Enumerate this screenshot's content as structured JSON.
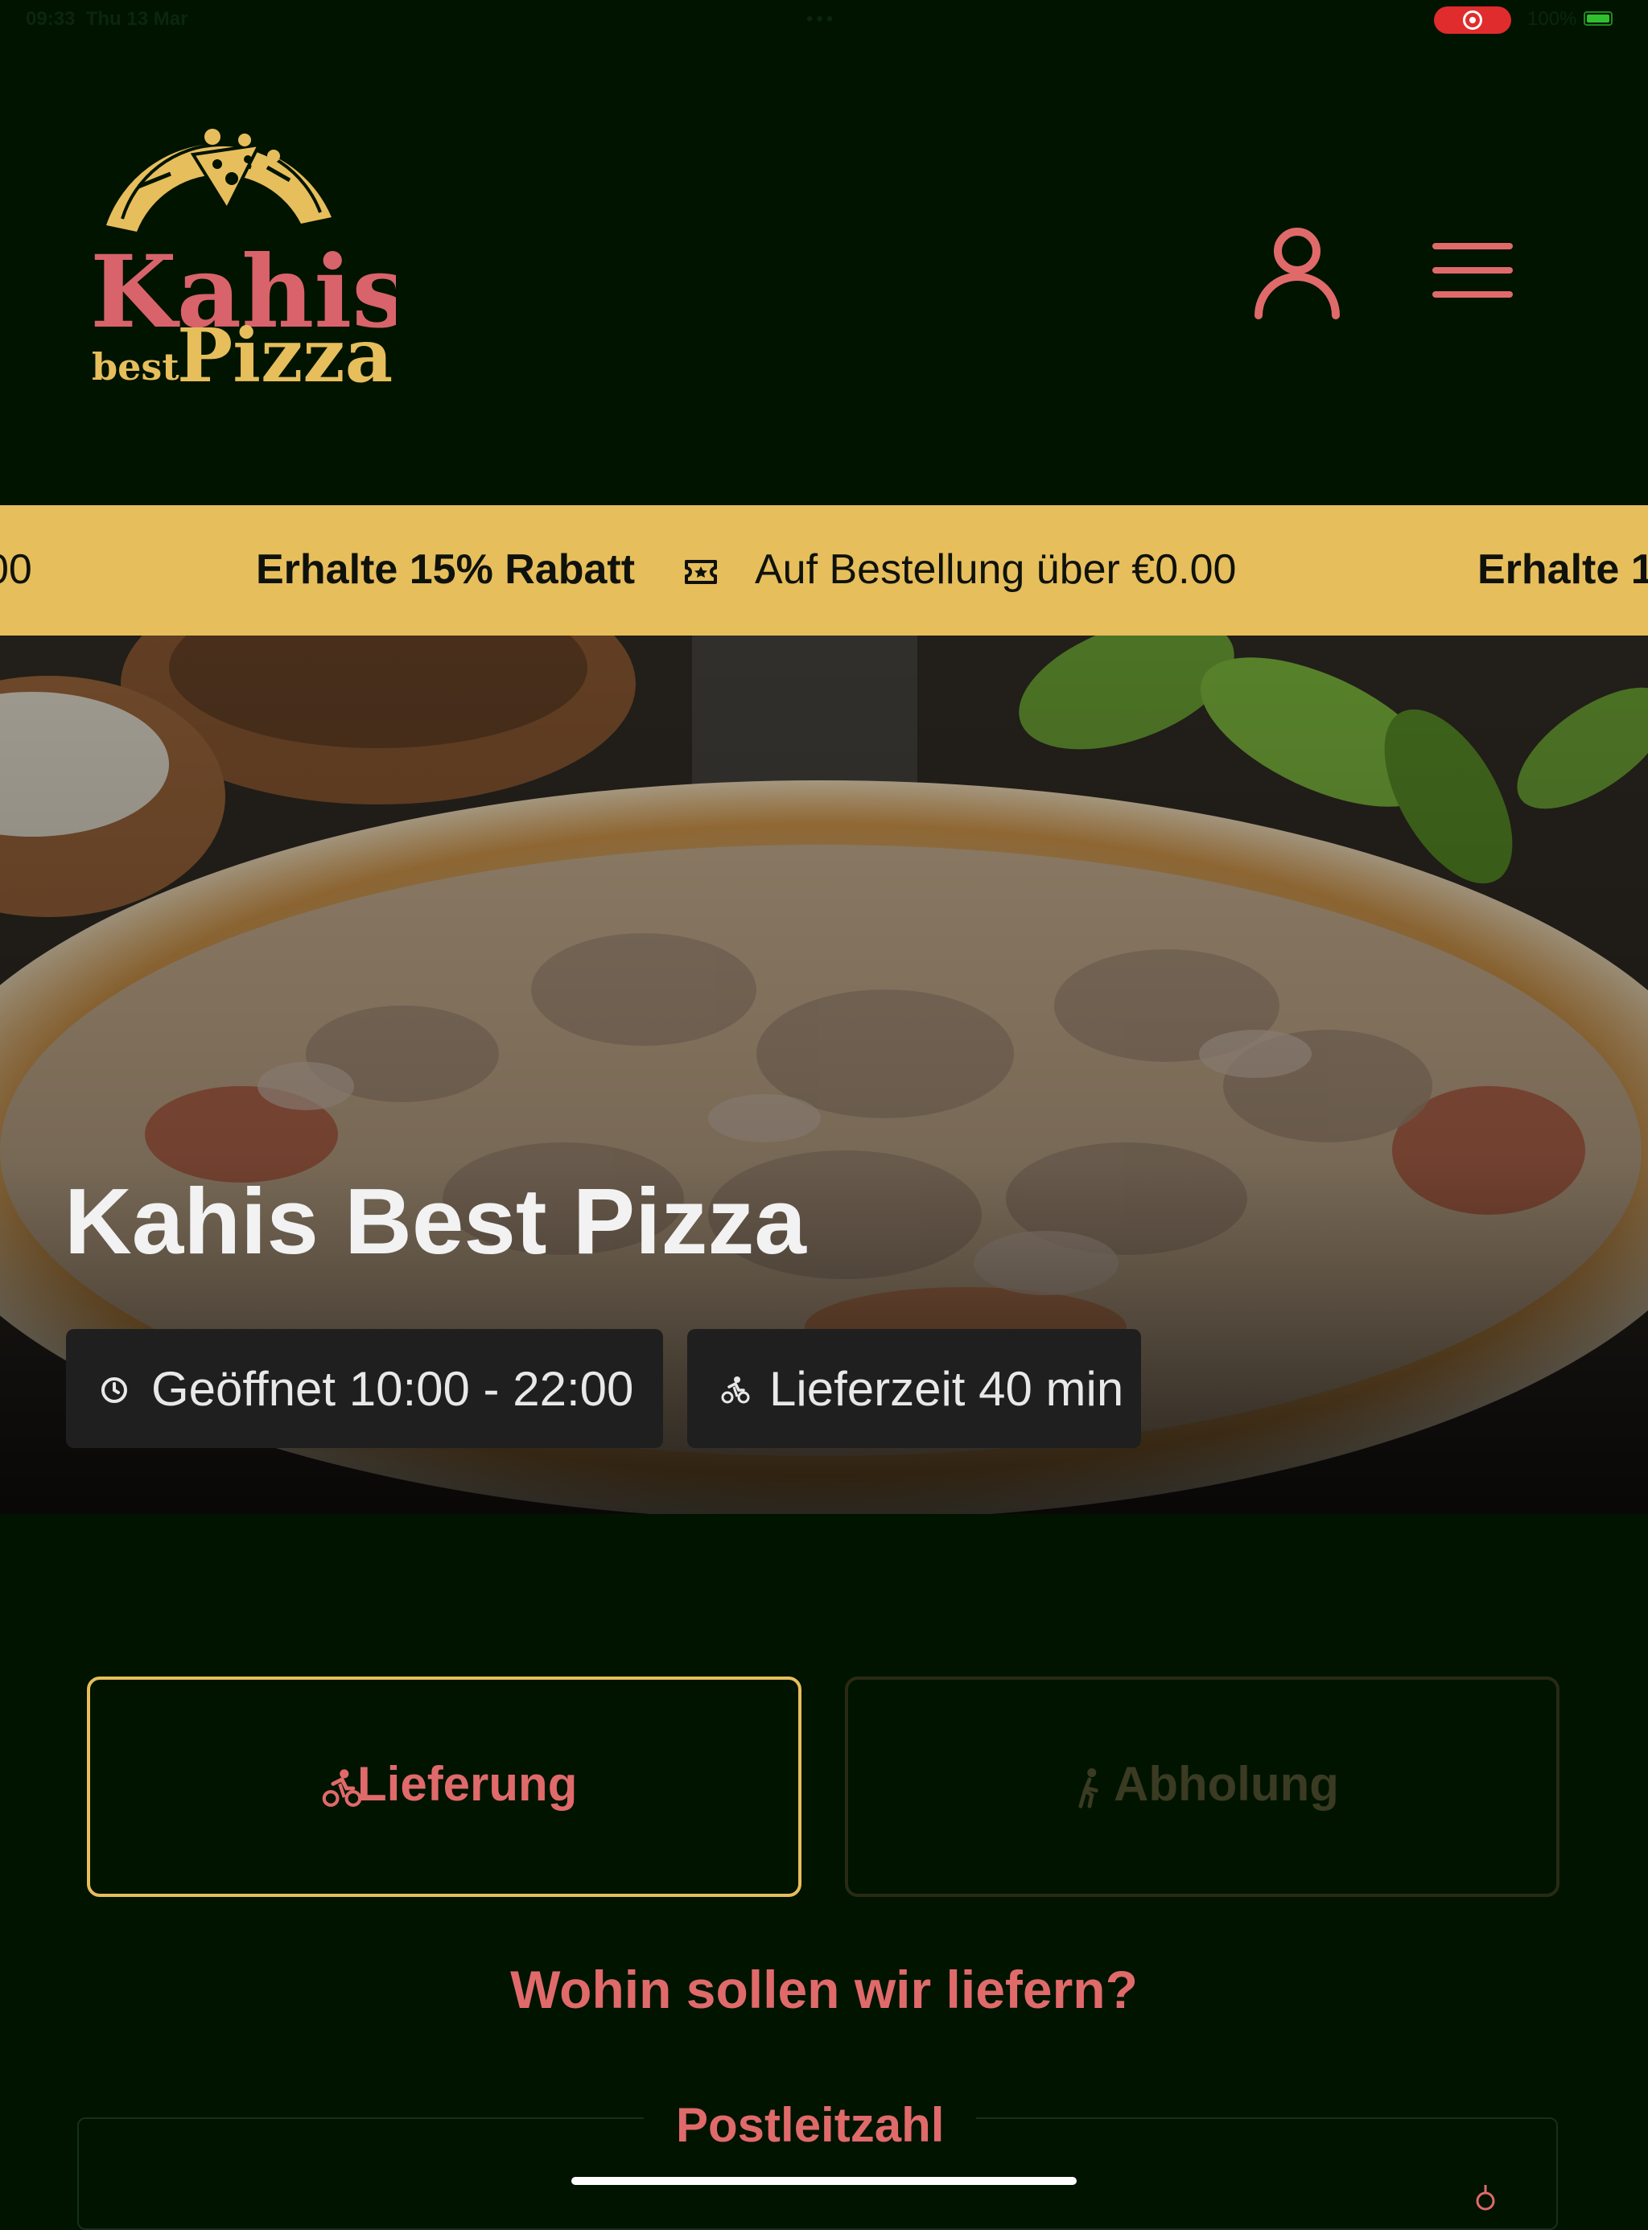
{
  "status_bar": {
    "time": "09:33",
    "date": "Thu 13 Mar",
    "battery": "100%"
  },
  "header": {
    "logo": {
      "word1": "Kahis",
      "word2": "best",
      "word3": "Pizza"
    },
    "user_icon": "user-icon",
    "menu_icon": "hamburger-menu-icon"
  },
  "promo": {
    "left_fragment": "00",
    "offer": "Erhalte 15% Rabatt",
    "condition": "Auf Bestellung über €0.00",
    "right_fragment": "Erhalte 1",
    "icon": "ticket-icon",
    "background_color": "#e7be5c"
  },
  "hero": {
    "title": "Kahis Best Pizza",
    "opening_hours": "Geöffnet 10:00 - 22:00",
    "delivery_time": "Lieferzeit 40 min"
  },
  "order_mode": {
    "delivery_label": "Lieferung",
    "pickup_label": "Abholung",
    "selected": "delivery"
  },
  "delivery_form": {
    "question": "Wohin sollen wir liefern?",
    "zip_label": "Postleitzahl"
  },
  "colors": {
    "background": "#001400",
    "accent_gold": "#e7be5c",
    "accent_red": "#e06a6a"
  }
}
